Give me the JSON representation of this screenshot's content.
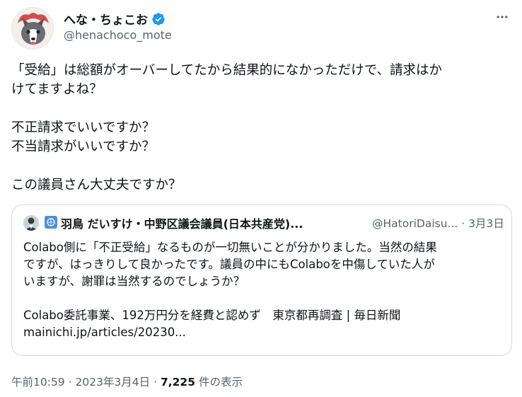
{
  "author": {
    "display_name": "へな・ちょこお",
    "handle": "@henachoco_mote",
    "verified": true
  },
  "tweet": {
    "lines": [
      "「受給」は総額がオーバーしてたから結果的になかっただけで、請求はか",
      "けてますよね？",
      "",
      "不正請求でいいですか？",
      "不当請求がいいですか？",
      "",
      "この議員さん大丈夫ですか？"
    ]
  },
  "quote": {
    "name": "羽鳥 だいすけ・中野区議会議員(日本共産党)...",
    "handle": "@HatoriDaisu...",
    "separator": "·",
    "date": "3月3日",
    "lines": [
      "Colabo側に「不正受給」なるものが一切無いことが分かりました。当然の結果",
      "ですが、はっきりして良かったです。議員の中にもColaboを中傷していた人が",
      "いますが、謝罪は当然するのでしょうか？",
      "",
      "Colabo委託事業、192万円分を経費と認めず　東京都再調査 | 毎日新聞",
      "mainichi.jp/articles/20230..."
    ]
  },
  "meta": {
    "time": "午前10:59",
    "dot1": "·",
    "date": "2023年3月4日",
    "dot2": "·",
    "views_count": "7,225",
    "views_label": "件の表示"
  },
  "colors": {
    "verified": "#1d9bf0",
    "secondary_text": "#536471",
    "border": "#cfd9de"
  },
  "icons": [
    "avatar",
    "verified-badge-icon",
    "more-options-icon",
    "un-flag-icon"
  ]
}
